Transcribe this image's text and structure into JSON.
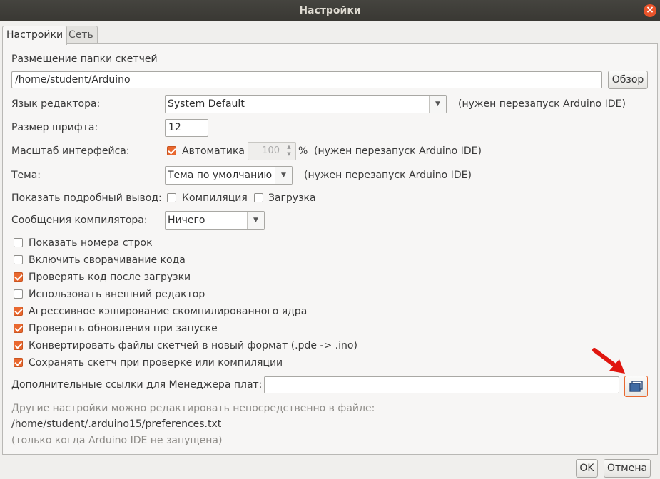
{
  "window": {
    "title": "Настройки",
    "close_icon": "close-icon"
  },
  "tabs": [
    {
      "label": "Настройки",
      "active": true
    },
    {
      "label": "Сеть",
      "active": false
    }
  ],
  "sketchbook": {
    "label": "Размещение папки скетчей",
    "path": "/home/student/Arduino",
    "browse_label": "Обзор"
  },
  "editor_language": {
    "label": "Язык редактора:",
    "value": "System Default",
    "note": "(нужен перезапуск Arduino IDE)"
  },
  "font_size": {
    "label": "Размер шрифта:",
    "value": "12"
  },
  "interface_scale": {
    "label": "Масштаб интерфейса:",
    "auto_label": "Автоматика",
    "auto_checked": true,
    "value": "100",
    "unit": "%",
    "note": "(нужен перезапуск Arduino IDE)"
  },
  "theme": {
    "label": "Тема:",
    "value": "Тема по умолчанию",
    "note": "(нужен перезапуск Arduino IDE)"
  },
  "verbose": {
    "label": "Показать подробный вывод:",
    "compile_label": "Компиляция",
    "compile_checked": false,
    "upload_label": "Загрузка",
    "upload_checked": false
  },
  "compiler_warnings": {
    "label": "Сообщения компилятора:",
    "value": "Ничего"
  },
  "options": [
    {
      "label": "Показать номера строк",
      "checked": false
    },
    {
      "label": "Включить сворачивание кода",
      "checked": false
    },
    {
      "label": "Проверять код после загрузки",
      "checked": true
    },
    {
      "label": "Использовать внешний редактор",
      "checked": false
    },
    {
      "label": "Агрессивное кэширование скомпилированного ядра",
      "checked": true
    },
    {
      "label": "Проверять обновления при запуске",
      "checked": true
    },
    {
      "label": "Конвертировать файлы скетчей в новый формат (.pde -> .ino)",
      "checked": true
    },
    {
      "label": "Сохранять скетч при проверке или компиляции",
      "checked": true
    }
  ],
  "board_manager": {
    "label": "Дополнительные ссылки для Менеджера плат:",
    "value": "",
    "button_icon": "window-list-icon"
  },
  "footer": {
    "more_prefs": "Другие настройки можно редактировать непосредственно в файле:",
    "prefs_path": "/home/student/.arduino15/preferences.txt",
    "note": "(только когда Arduino IDE не запущена)"
  },
  "buttons": {
    "ok": "OK",
    "cancel": "Отмена"
  },
  "colors": {
    "accent": "#e9682f",
    "annotation_arrow": "#e0160f",
    "titlebar": "#3c3b37"
  }
}
